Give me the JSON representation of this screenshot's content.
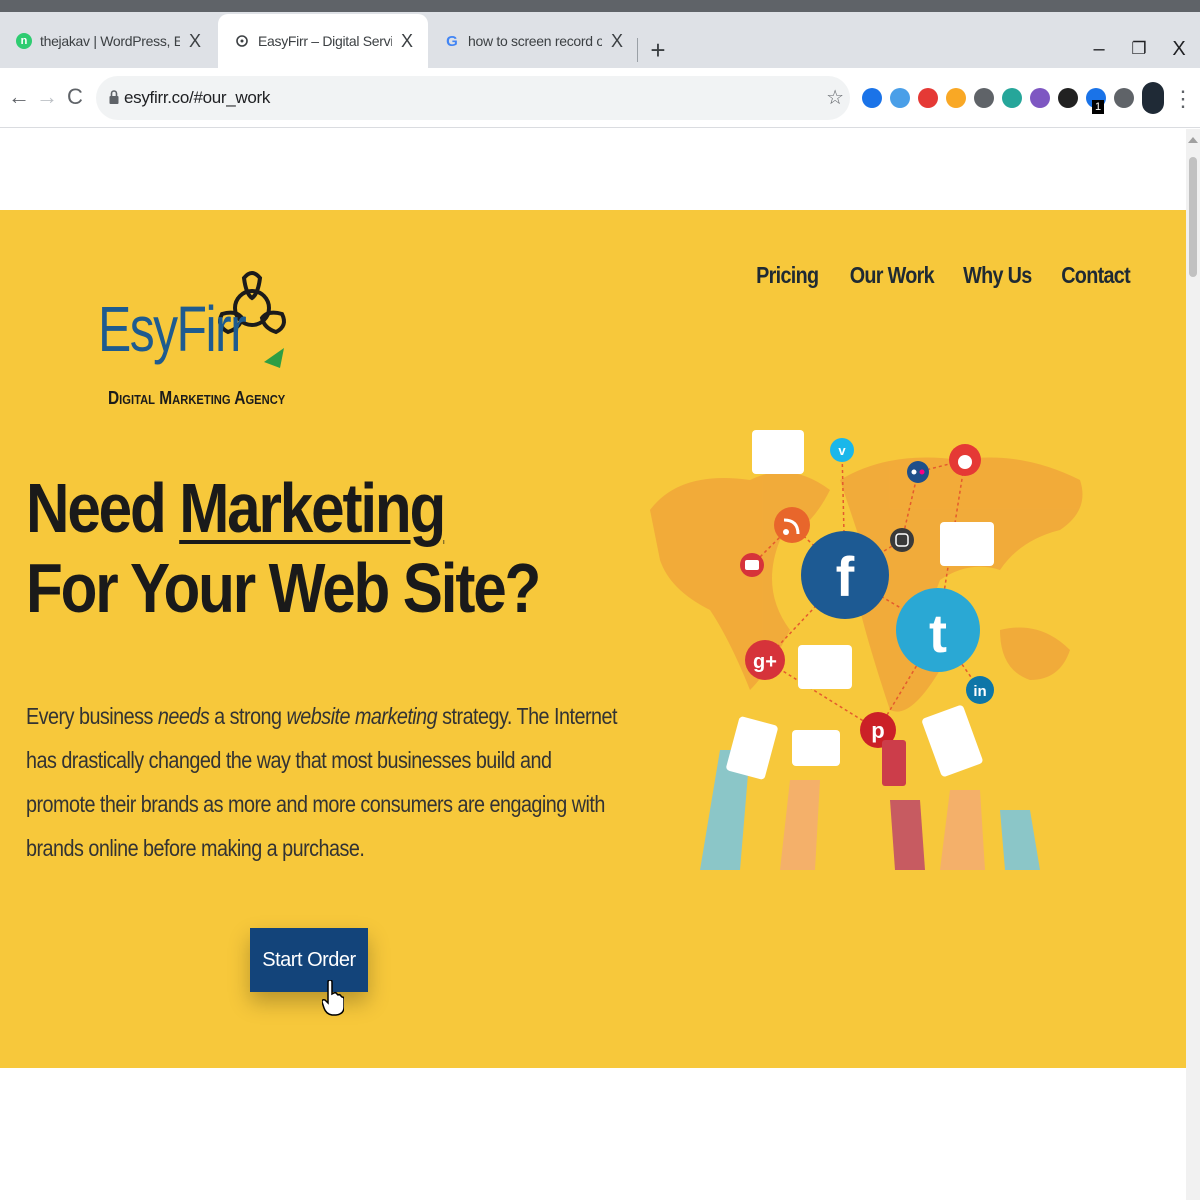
{
  "browser": {
    "tabs": [
      {
        "title": "thejakav | WordPress, Email Mark",
        "close": "X",
        "favicon_color": "#2ecc71",
        "favicon_letter": "n"
      },
      {
        "title": "EasyFirr – Digital Service Agency",
        "close": "X",
        "favicon_color": "#3c4043",
        "favicon_letter": ""
      },
      {
        "title": "how to screen record on window",
        "close": "X",
        "favicon_color": "#4285f4",
        "favicon_letter": "G"
      }
    ],
    "new_tab": "+",
    "window": {
      "minimize": "–",
      "restore": "❐",
      "close": "X"
    },
    "nav": {
      "back": "←",
      "forward": "→",
      "reload": "C"
    },
    "url": "esyfirr.co/#our_work",
    "bookmark_star": "☆",
    "menu": "⋮",
    "extension_badge": "1",
    "extensions": [
      "#1a73e8",
      "#4a9fe8",
      "#e53935",
      "#f9a825",
      "#5f6368",
      "#26a69a",
      "#7e57c2",
      "#212121",
      "#1a73e8",
      "#5f6368"
    ]
  },
  "site": {
    "logo": {
      "word": "EsyFirr",
      "subtitle": "Digital Marketing Agency"
    },
    "nav": [
      "Pricing",
      "Our Work",
      "Why Us",
      "Contact"
    ],
    "headline": {
      "line1_prefix": "Need ",
      "line1_emph": "Marketing",
      "line2": "For Your Web Site?"
    },
    "paragraph": {
      "p1": "Every business ",
      "p2": "needs",
      "p3": " a strong ",
      "p4": "website marketing",
      "p5": " strategy. The Internet has drastically changed the way that most businesses build and promote their brands as more and more consumers are engaging with brands online before making a purchase."
    },
    "cta": "Start Order",
    "colors": {
      "hero_bg": "#f7c83b",
      "cta_bg": "#13447a",
      "logo_blue": "#1e5b8f"
    },
    "illustration_icons": [
      "facebook-icon",
      "twitter-icon",
      "google-plus-icon",
      "pinterest-icon",
      "linkedin-icon",
      "rss-icon",
      "youtube-icon",
      "reddit-icon",
      "vimeo-icon",
      "instagram-icon",
      "flickr-icon"
    ]
  }
}
